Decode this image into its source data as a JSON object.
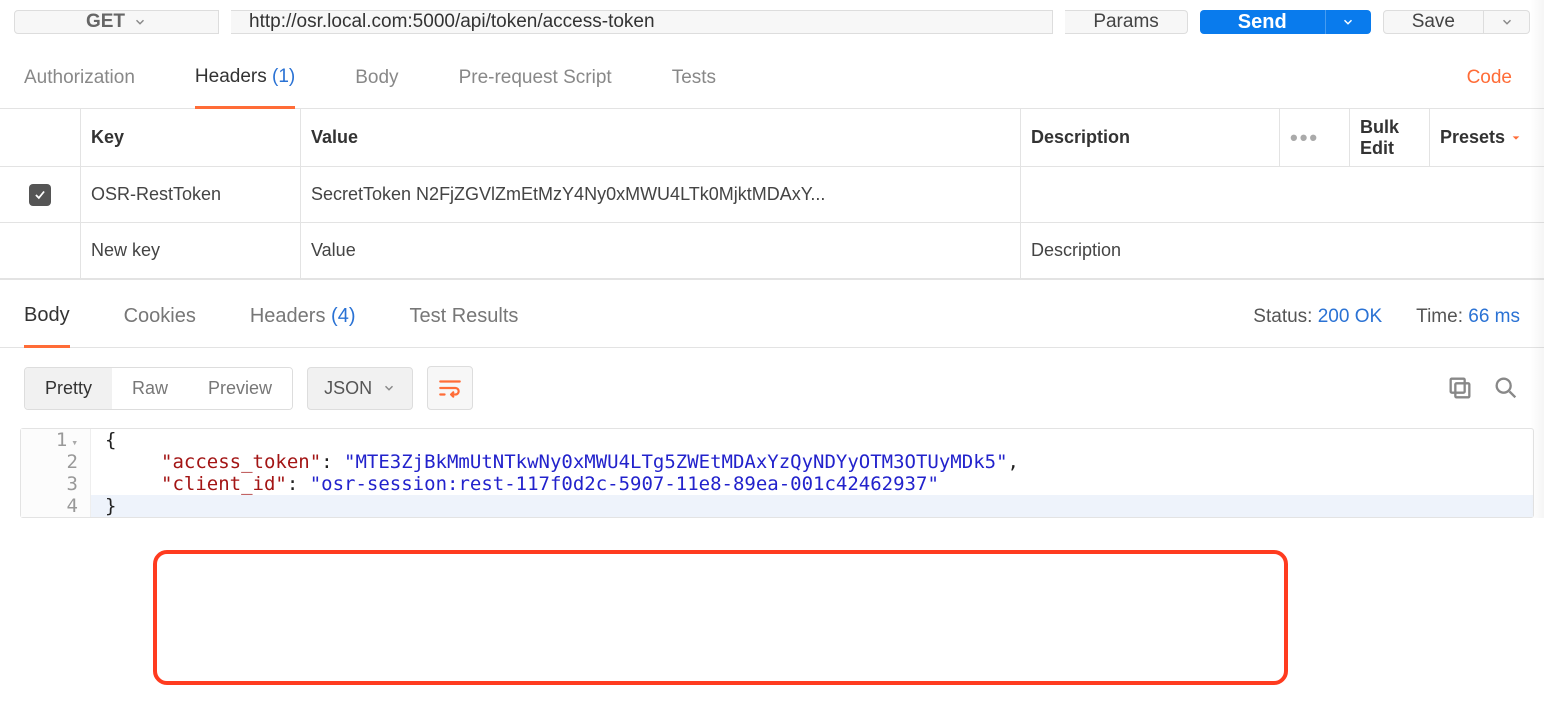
{
  "request": {
    "method": "GET",
    "url": "http://osr.local.com:5000/api/token/access-token",
    "params_label": "Params",
    "send_label": "Send",
    "save_label": "Save"
  },
  "req_tabs": {
    "authorization": "Authorization",
    "headers": "Headers",
    "headers_count": "(1)",
    "body": "Body",
    "pre_request": "Pre-request Script",
    "tests": "Tests",
    "code": "Code"
  },
  "headers_table": {
    "cols": {
      "key": "Key",
      "value": "Value",
      "description": "Description",
      "bulk_edit": "Bulk Edit",
      "presets": "Presets"
    },
    "rows": [
      {
        "enabled": true,
        "key": "OSR-RestToken",
        "value": "SecretToken N2FjZGVlZmEtMzY4Ny0xMWU4LTk0MjktMDAxY...",
        "description": ""
      }
    ],
    "new_key_placeholder": "New key",
    "new_value_placeholder": "Value",
    "new_desc_placeholder": "Description"
  },
  "resp_tabs": {
    "body": "Body",
    "cookies": "Cookies",
    "headers": "Headers",
    "headers_count": "(4)",
    "test_results": "Test Results"
  },
  "resp_meta": {
    "status_label": "Status:",
    "status_value": "200 OK",
    "time_label": "Time:",
    "time_value": "66 ms"
  },
  "body_toolbar": {
    "pretty": "Pretty",
    "raw": "Raw",
    "preview": "Preview",
    "format": "JSON"
  },
  "response_body": {
    "access_token_key": "\"access_token\"",
    "access_token_val": "\"MTE3ZjBkMmUtNTkwNy0xMWU4LTg5ZWEtMDAxYzQyNDYyOTM3OTUyMDk5\"",
    "client_id_key": "\"client_id\"",
    "client_id_val": "\"osr-session:rest-117f0d2c-5907-11e8-89ea-001c42462937\"",
    "line_numbers": [
      "1",
      "2",
      "3",
      "4"
    ]
  }
}
